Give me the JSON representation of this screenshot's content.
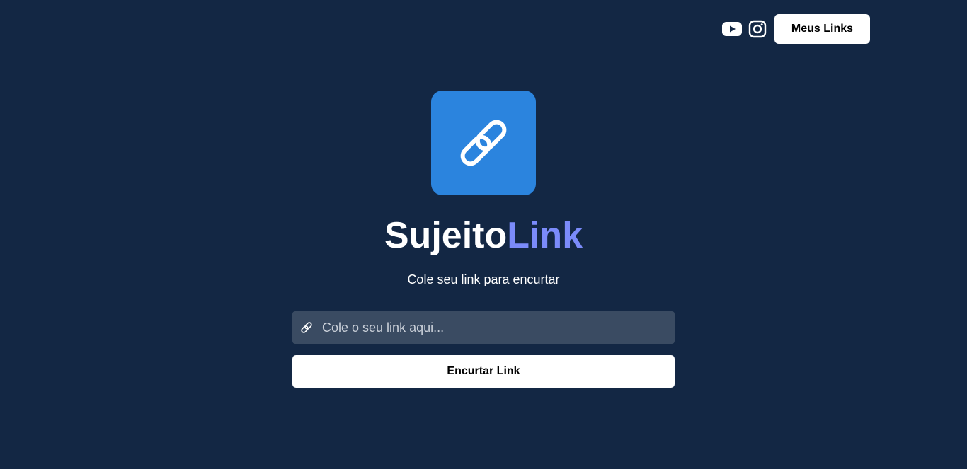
{
  "header": {
    "my_links_label": "Meus Links"
  },
  "brand": {
    "name_part1": "Sujeito",
    "name_part2": "Link",
    "part1_color": "#ffffff",
    "part2_color": "#7B8BFA",
    "logo_bg_color": "#2B84DE"
  },
  "subtitle": "Cole seu link para encurtar",
  "form": {
    "input_placeholder": "Cole o seu link aqui...",
    "input_value": "",
    "submit_label": "Encurtar Link"
  },
  "icons": {
    "youtube": "youtube-icon",
    "instagram": "instagram-icon",
    "logo": "chain-link-icon",
    "input": "link-icon"
  },
  "colors": {
    "background": "#132744",
    "input_bg": "#3A4B62"
  }
}
